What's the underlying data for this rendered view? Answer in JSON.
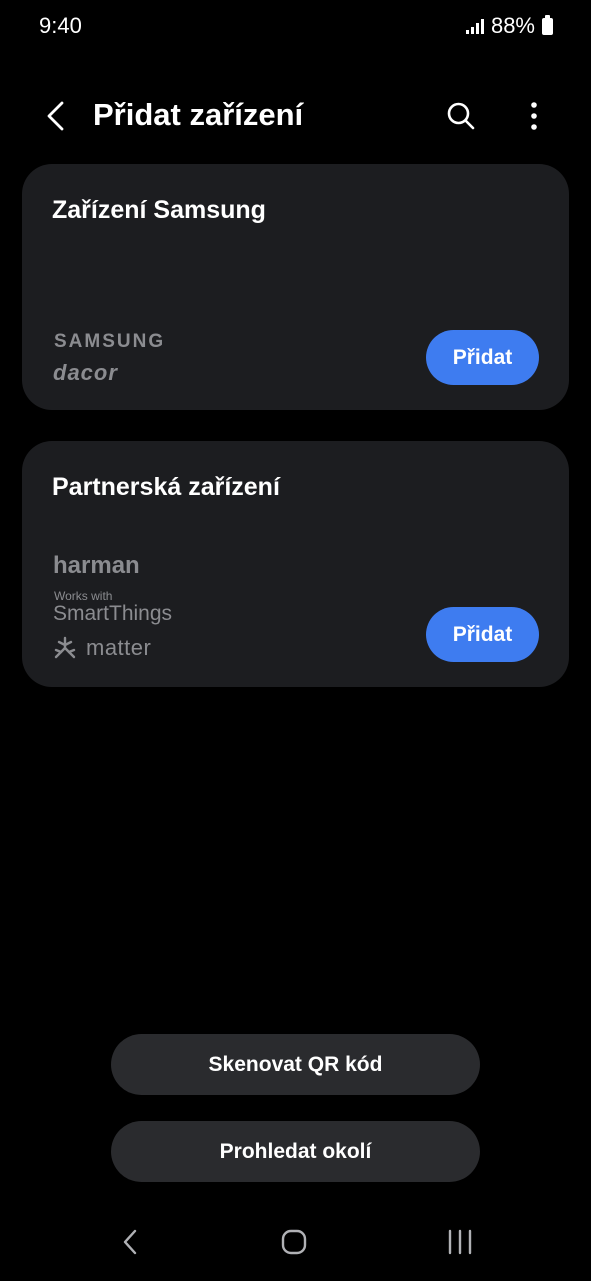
{
  "status_bar": {
    "time": "9:40",
    "battery": "88%"
  },
  "header": {
    "title": "Přidat zařízení",
    "icons": [
      "back-arrow-icon",
      "search-icon",
      "more-vertical-icon"
    ]
  },
  "cards": {
    "samsung": {
      "title": "Zařízení Samsung",
      "brands": [
        "SAMSUNG",
        "dacor"
      ],
      "button_label": "Přidat"
    },
    "partner": {
      "title": "Partnerská zařízení",
      "brands": [
        "harman",
        "Works with",
        "SmartThings",
        "matter"
      ],
      "button_label": "Přidat"
    }
  },
  "actions": {
    "scan_qr": "Skenovat QR kód",
    "scan_nearby": "Prohledat okolí"
  },
  "colors": {
    "background": "#000000",
    "card": "#1c1d20",
    "accent": "#3e7cf0",
    "secondary_button": "#2a2b2e",
    "brand_text": "#8b8c90"
  },
  "nav": {
    "icons": [
      "nav-back-icon",
      "nav-home-icon",
      "nav-recents-icon"
    ]
  }
}
